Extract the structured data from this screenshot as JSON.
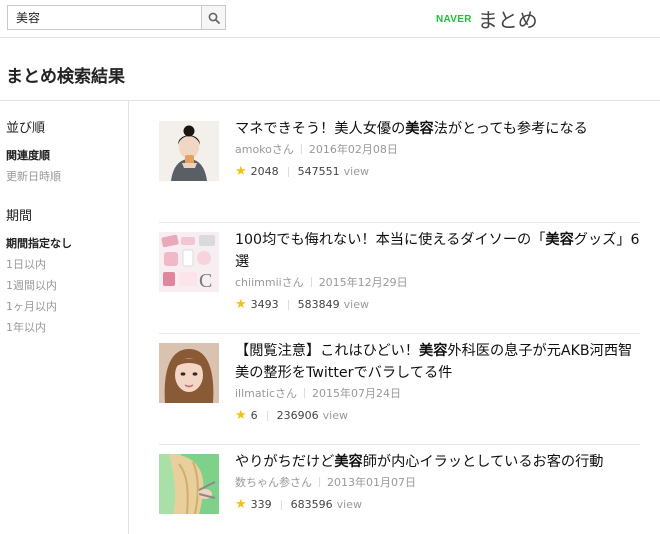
{
  "search": {
    "value": "美容",
    "button_icon": "search-icon"
  },
  "brand": {
    "naver": "NAVER",
    "matome": "まとめ",
    "naver_color": "#1fbf3b"
  },
  "page_title": "まとめ検索結果",
  "sidebar": {
    "sort": {
      "heading": "並び順",
      "items": [
        {
          "label": "関連度順",
          "active": true
        },
        {
          "label": "更新日時順",
          "active": false
        }
      ]
    },
    "period": {
      "heading": "期間",
      "items": [
        {
          "label": "期間指定なし",
          "active": true
        },
        {
          "label": "1日以内",
          "active": false
        },
        {
          "label": "1週間以内",
          "active": false
        },
        {
          "label": "1ヶ月以内",
          "active": false
        },
        {
          "label": "1年以内",
          "active": false
        }
      ]
    }
  },
  "results": [
    {
      "title_before": "マネできそう！美人女優の",
      "title_keyword": "美容",
      "title_after": "法がとっても参考になる",
      "author": "amokoさん",
      "date": "2016年02月08日",
      "favorites": "2048",
      "views": "547551",
      "view_label": "view"
    },
    {
      "title_before": "100均でも侮れない！本当に使えるダイソーの「",
      "title_keyword": "美容",
      "title_after": "グッズ」6選",
      "author": "chiimmiiさん",
      "date": "2015年12月29日",
      "favorites": "3493",
      "views": "583849",
      "view_label": "view"
    },
    {
      "title_before": "【閲覧注意】これはひどい！",
      "title_keyword": "美容",
      "title_after": "外科医の息子が元AKB河西智美の整形をTwitterでバラしてる件",
      "author": "illmaticさん",
      "date": "2015年07月24日",
      "favorites": "6",
      "views": "236906",
      "view_label": "view"
    },
    {
      "title_before": "やりがちだけど",
      "title_keyword": "美容",
      "title_after": "師が内心イラッとしているお客の行動",
      "author": "数ちゃん参さん",
      "date": "2013年01月07日",
      "favorites": "339",
      "views": "683596",
      "view_label": "view"
    }
  ],
  "icons": {
    "favorite": "star-icon"
  }
}
